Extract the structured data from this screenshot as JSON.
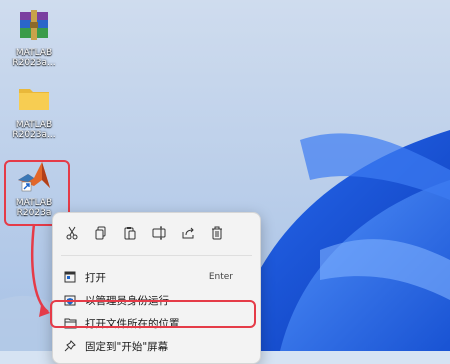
{
  "desktop": {
    "icons": [
      {
        "label_line1": "MATLAB",
        "label_line2": "R2023a..."
      },
      {
        "label_line1": "MATLAB",
        "label_line2": "R2023a..."
      },
      {
        "label_line1": "MATLAB",
        "label_line2": "R2023a"
      }
    ]
  },
  "context_menu": {
    "quick_actions": [
      {
        "name": "cut-icon"
      },
      {
        "name": "copy-icon"
      },
      {
        "name": "paste-icon"
      },
      {
        "name": "rename-icon"
      },
      {
        "name": "share-icon"
      },
      {
        "name": "delete-icon"
      }
    ],
    "items": [
      {
        "label": "打开",
        "shortcut": "Enter",
        "icon": "open-icon"
      },
      {
        "label": "以管理员身份运行",
        "icon": "shield-icon"
      },
      {
        "label": "打开文件所在的位置",
        "icon": "folder-icon"
      },
      {
        "label": "固定到\"开始\"屏幕",
        "icon": "pin-icon"
      }
    ]
  },
  "colors": {
    "highlight": "#e53b48",
    "wallpaper_blue": "#1c5fd6",
    "menu_bg": "#f3f3f3"
  }
}
